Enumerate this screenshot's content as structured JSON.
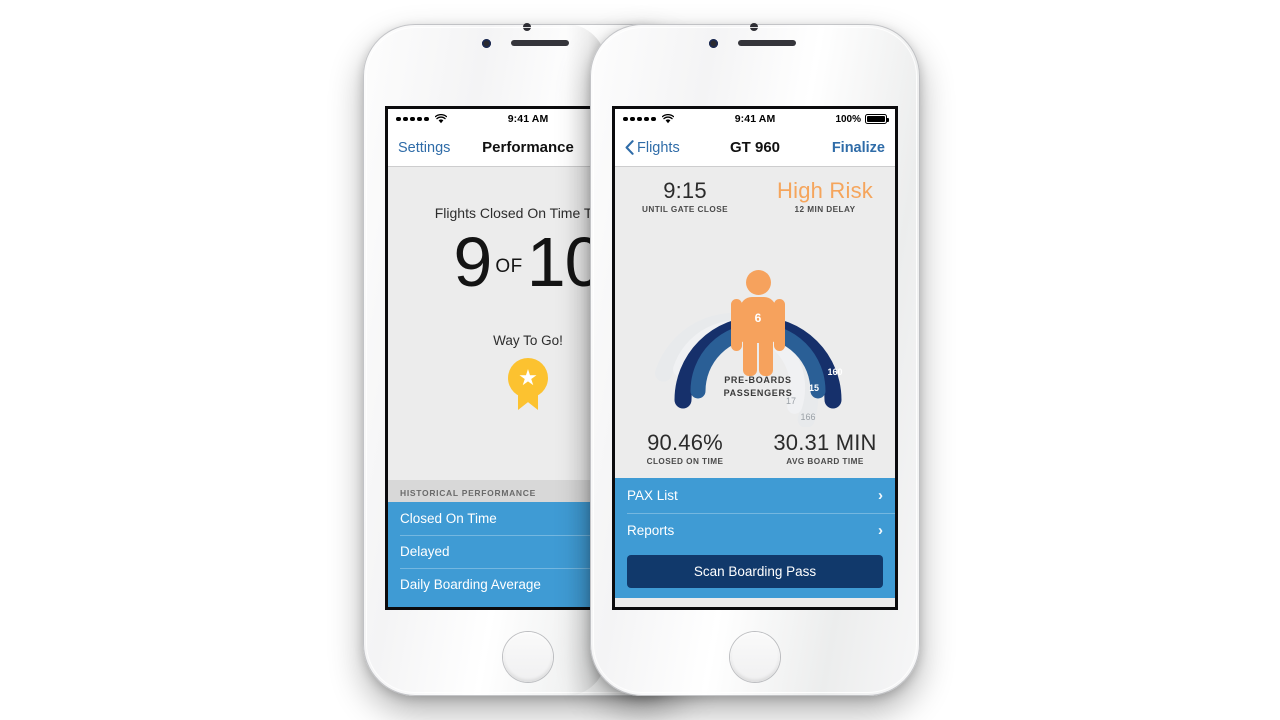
{
  "scene": {
    "description": "Two white iPhones side by side showing an airline gate-agent boarding app"
  },
  "colors": {
    "navy": "#16306b",
    "steel_blue": "#2a5f96",
    "light_track": "#e8eaec",
    "row_blue": "#3f9bd4",
    "button_navy": "#11396b",
    "orange": "#f6a25d",
    "screen_bg": "#ececec",
    "link_blue": "#2f6ca8",
    "gold": "#fcc230"
  },
  "left_phone": {
    "status_bar": {
      "time": "9:41 AM",
      "signal_icon": "signal-dots-icon",
      "wifi_icon": "wifi-icon"
    },
    "nav": {
      "back_label": "Settings",
      "title": "Performance"
    },
    "headline": "Flights Closed On Time Today",
    "score": {
      "value": "9",
      "separator": "OF",
      "total": "10"
    },
    "praise": "Way To Go!",
    "badge_icon": "star-medal-icon",
    "section_header": "HISTORICAL PERFORMANCE",
    "rows": [
      {
        "label": "Closed On Time"
      },
      {
        "label": "Delayed"
      },
      {
        "label": "Daily Boarding Average"
      }
    ]
  },
  "right_phone": {
    "status_bar": {
      "time": "9:41 AM",
      "battery_percent": "100%",
      "signal_icon": "signal-dots-icon",
      "wifi_icon": "wifi-icon",
      "battery_icon": "battery-full-icon"
    },
    "nav": {
      "back_icon": "chevron-left-icon",
      "back_label": "Flights",
      "title": "GT 960",
      "action_label": "Finalize"
    },
    "kpi_top": [
      {
        "value": "9:15",
        "label": "UNTIL GATE CLOSE",
        "risk": false
      },
      {
        "value": "High Risk",
        "label": "12 MIN DELAY",
        "risk": true
      }
    ],
    "gauge": {
      "center_count": "6",
      "center_label_line1": "PRE-BOARDS",
      "center_label_line2": "PASSENGERS",
      "arcs": [
        {
          "name": "boarded",
          "value": "160",
          "color": "#16306b"
        },
        {
          "name": "pre-boards-scanned",
          "value": "15",
          "color": "#2a5f96"
        },
        {
          "name": "capacity-inner",
          "value": "17",
          "color": "#f0f1f3"
        },
        {
          "name": "capacity-outer",
          "value": "166",
          "color": "#e8eaec"
        }
      ]
    },
    "kpi_bottom": [
      {
        "value": "90.46%",
        "label": "CLOSED ON TIME"
      },
      {
        "value": "30.31 MIN",
        "label": "AVG BOARD TIME"
      }
    ],
    "rows": [
      {
        "label": "PAX List",
        "chevron": "›"
      },
      {
        "label": "Reports",
        "chevron": "›"
      }
    ],
    "primary_button": "Scan Boarding Pass"
  }
}
